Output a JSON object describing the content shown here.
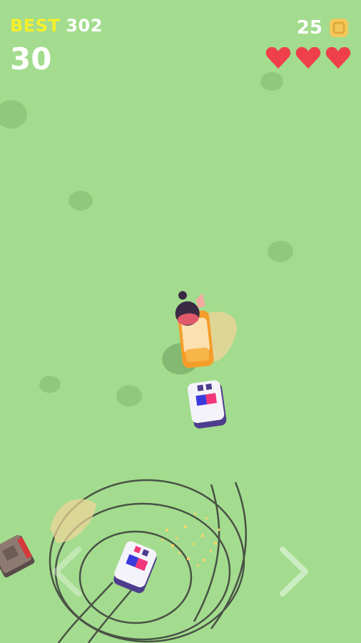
{
  "hud": {
    "best_label": "BEST",
    "best_value": "302",
    "score": "30",
    "coins": "25",
    "lives": 3
  },
  "colors": {
    "grass": "#a3dc8e",
    "grass_patch": "#8fca7c",
    "best_label": "#f6ef2a",
    "heart": "#ef3f4b",
    "coin": "#f3c85a",
    "player_car": "#f59d2a",
    "police_car": "#f5f3fa",
    "police_light_red": "#f2367a",
    "police_light_blue": "#3b3bdc",
    "skid_mark": "#3a3a3a"
  },
  "icons": {
    "coin": "coin-icon",
    "life": "heart-icon",
    "steer_left": "chevron-left-icon",
    "steer_right": "chevron-right-icon"
  }
}
